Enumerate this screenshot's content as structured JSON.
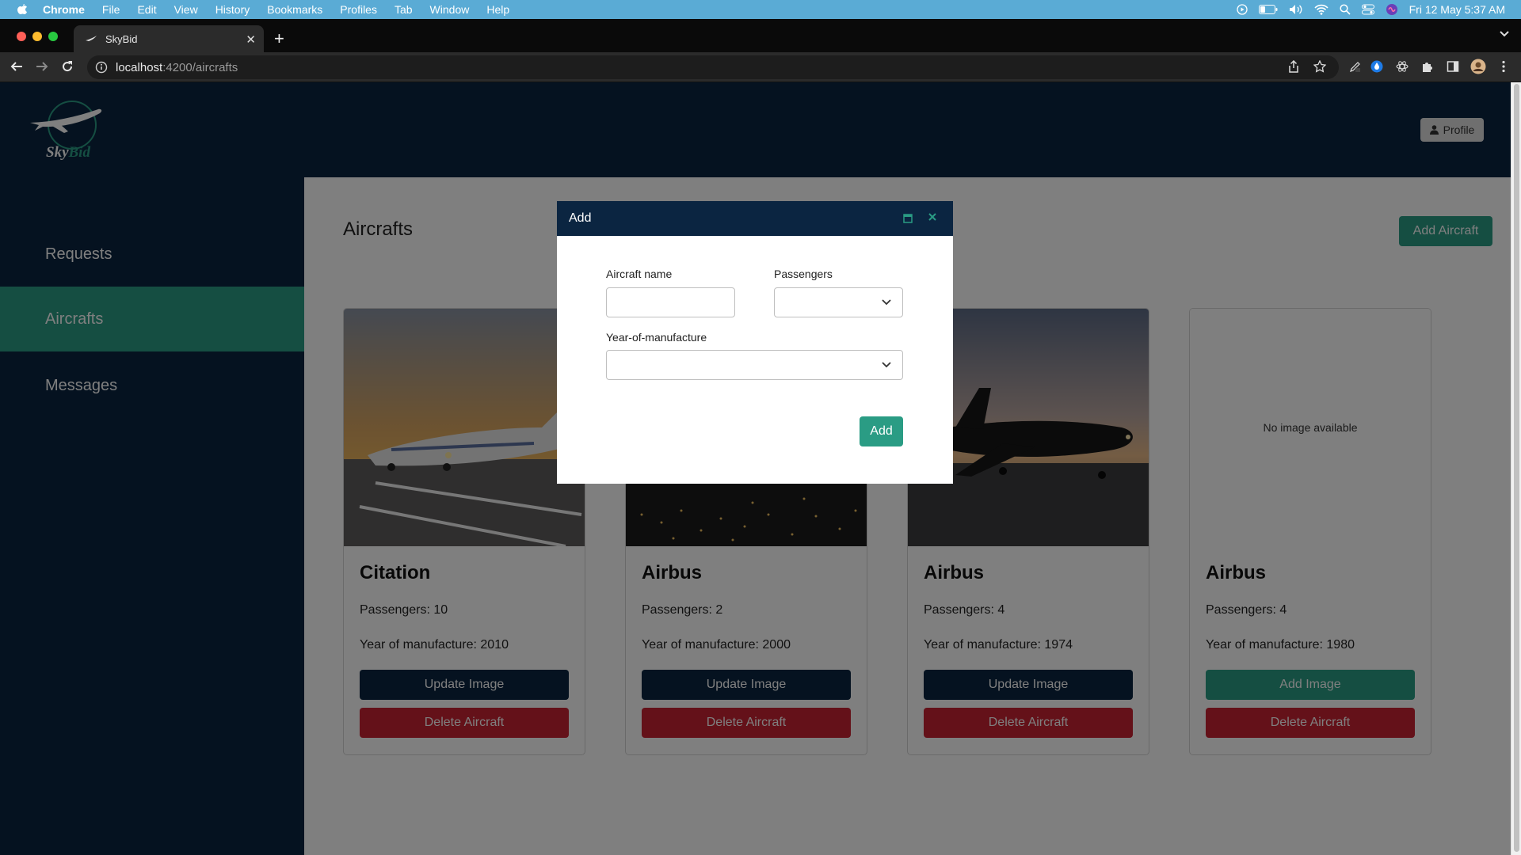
{
  "menubar": {
    "items": [
      "Chrome",
      "File",
      "Edit",
      "View",
      "History",
      "Bookmarks",
      "Profiles",
      "Tab",
      "Window",
      "Help"
    ],
    "clock": "Fri 12 May  5:37 AM"
  },
  "browser": {
    "tab_title": "SkyBid",
    "url_host": "localhost",
    "url_path": ":4200/aircrafts"
  },
  "header": {
    "logo_text_a": "Sky",
    "logo_text_b": "Bid",
    "profile_label": "Profile"
  },
  "sidebar": {
    "items": [
      {
        "label": "Requests",
        "active": false
      },
      {
        "label": "Aircrafts",
        "active": true
      },
      {
        "label": "Messages",
        "active": false
      }
    ]
  },
  "main": {
    "title": "Aircrafts",
    "add_button": "Add Aircraft"
  },
  "cards": [
    {
      "name": "Citation",
      "passengers": "Passengers: 10",
      "year": "Year of manufacture: 2010",
      "image_button": "Update Image",
      "delete_button": "Delete Aircraft",
      "no_image": ""
    },
    {
      "name": "Airbus",
      "passengers": "Passengers: 2",
      "year": "Year of manufacture: 2000",
      "image_button": "Update Image",
      "delete_button": "Delete Aircraft",
      "no_image": ""
    },
    {
      "name": "Airbus",
      "passengers": "Passengers: 4",
      "year": "Year of manufacture: 1974",
      "image_button": "Update Image",
      "delete_button": "Delete Aircraft",
      "no_image": ""
    },
    {
      "name": "Airbus",
      "passengers": "Passengers: 4",
      "year": "Year of manufacture: 1980",
      "image_button": "Add Image",
      "delete_button": "Delete Aircraft",
      "no_image": "No image available"
    }
  ],
  "dialog": {
    "title": "Add",
    "aircraft_name_label": "Aircraft name",
    "aircraft_name_value": "",
    "passengers_label": "Passengers",
    "passengers_value": "",
    "year_label": "Year-of-manufacture",
    "year_value": "",
    "add_button": "Add"
  },
  "colors": {
    "navy": "#0b2541",
    "accent": "#2a9c84",
    "danger": "#c82333"
  }
}
